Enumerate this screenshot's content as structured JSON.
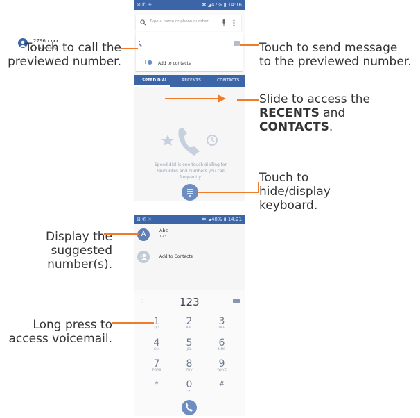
{
  "phone1": {
    "status_bar": {
      "left": "⊠ ✆ ☀",
      "right": "✱ ◢47% ▮ 14:16"
    },
    "search_placeholder": "Type a name or phone number",
    "contact": {
      "number": "2796 xxxx",
      "date": "↗ 4 January"
    },
    "add_to_contacts": "Add to contacts",
    "tabs": [
      "SPEED DIAL",
      "RECENTS",
      "CONTACTS"
    ],
    "speed_dial_text": "Speed dial is one touch dialling for Favourites and numbers you call frequently."
  },
  "phone2": {
    "status_bar": {
      "left": "⊠ ✆ ☀",
      "right": "✱ ◢48% ▮ 14:21"
    },
    "suggestion": {
      "avatar": "A",
      "name": "Abc",
      "number": "123"
    },
    "add_to_contacts": "Add to Contacts",
    "dial_value": "123",
    "keys": [
      {
        "n": "1",
        "s": "QO"
      },
      {
        "n": "2",
        "s": "ABC"
      },
      {
        "n": "3",
        "s": "DEF"
      },
      {
        "n": "4",
        "s": "GHI"
      },
      {
        "n": "5",
        "s": "JKL"
      },
      {
        "n": "6",
        "s": "MNO"
      },
      {
        "n": "7",
        "s": "PQRS"
      },
      {
        "n": "8",
        "s": "TUV"
      },
      {
        "n": "9",
        "s": "WXYZ"
      },
      {
        "n": "*",
        "s": ""
      },
      {
        "n": "0",
        "s": "+"
      },
      {
        "n": "#",
        "s": ""
      }
    ]
  },
  "annotations": {
    "call": "Touch to call the previewed number.",
    "message": "Touch to send message to the previewed number.",
    "slide_1": "Slide to access the",
    "slide_recents": "RECENTS",
    "slide_and": "and",
    "slide_contacts": "CONTACTS",
    "slide_period": ".",
    "keyboard": "Touch to hide/display keyboard.",
    "suggested": "Display the suggested number(s).",
    "voicemail": "Long press to access voicemail."
  },
  "colors": {
    "accent": "#f07c2a",
    "primary": "#3c65a8"
  }
}
